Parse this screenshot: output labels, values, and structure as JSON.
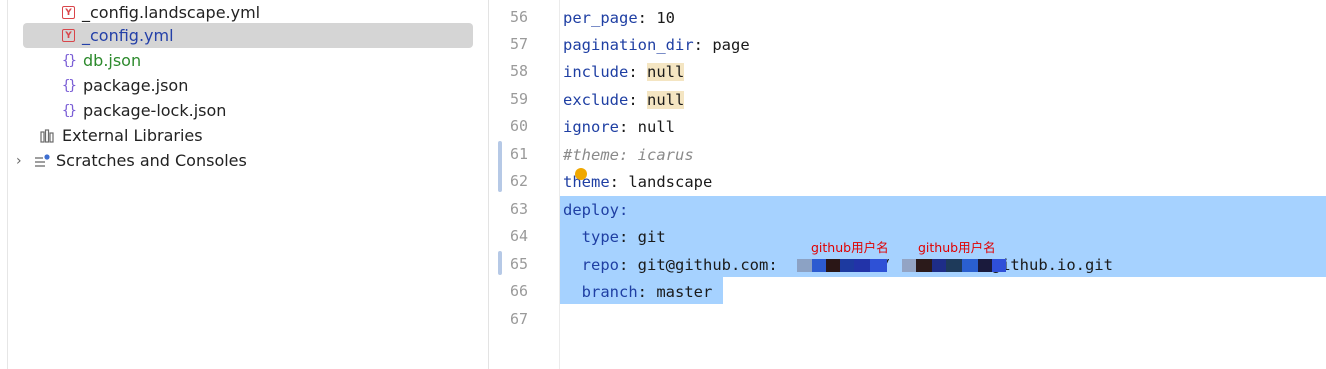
{
  "project_tree": {
    "items": [
      {
        "label": "_config.landscape.yml",
        "icon": "yaml-file-icon",
        "selected": false
      },
      {
        "label": "_config.yml",
        "icon": "yaml-file-icon",
        "selected": true
      },
      {
        "label": "db.json",
        "icon": "json-file-icon",
        "selected": false
      },
      {
        "label": "package.json",
        "icon": "json-file-icon",
        "selected": false
      },
      {
        "label": "package-lock.json",
        "icon": "json-file-icon",
        "selected": false
      },
      {
        "label": "External Libraries",
        "icon": "library-icon",
        "selected": false
      },
      {
        "label": "Scratches and Consoles",
        "icon": "scratches-icon",
        "selected": false
      }
    ],
    "colors": {
      "selected_text": "#2440a8",
      "untracked_text": "#2d8a2d"
    }
  },
  "editor": {
    "lines": [
      {
        "num": "56",
        "key": "per_page",
        "value": "10"
      },
      {
        "num": "57",
        "key": "pagination_dir",
        "value": "page"
      },
      {
        "num": "58",
        "key": "include",
        "value": "null"
      },
      {
        "num": "59",
        "key": "exclude",
        "value": "null"
      },
      {
        "num": "60",
        "key": "ignore",
        "value": "null"
      },
      {
        "num": "61",
        "comment": "#theme: icarus"
      },
      {
        "num": "62",
        "key": "theme",
        "value": "landscape"
      },
      {
        "num": "63",
        "key": "deploy",
        "value": ""
      },
      {
        "num": "64",
        "key": "  type",
        "value": "git"
      },
      {
        "num": "65",
        "key": "  repo",
        "value_prefix": "git@github.com:",
        "value_mid": "C/",
        "value_suffix": ".github.io.git"
      },
      {
        "num": "66",
        "key": "  branch",
        "value": "master"
      },
      {
        "num": "67"
      }
    ],
    "annotations": [
      "github用户名",
      "github用户名"
    ],
    "colors": {
      "key": "#1f3fa3",
      "selection": "#a6d2ff",
      "comment": "#8a8a8a",
      "annotation": "#e00000"
    }
  }
}
